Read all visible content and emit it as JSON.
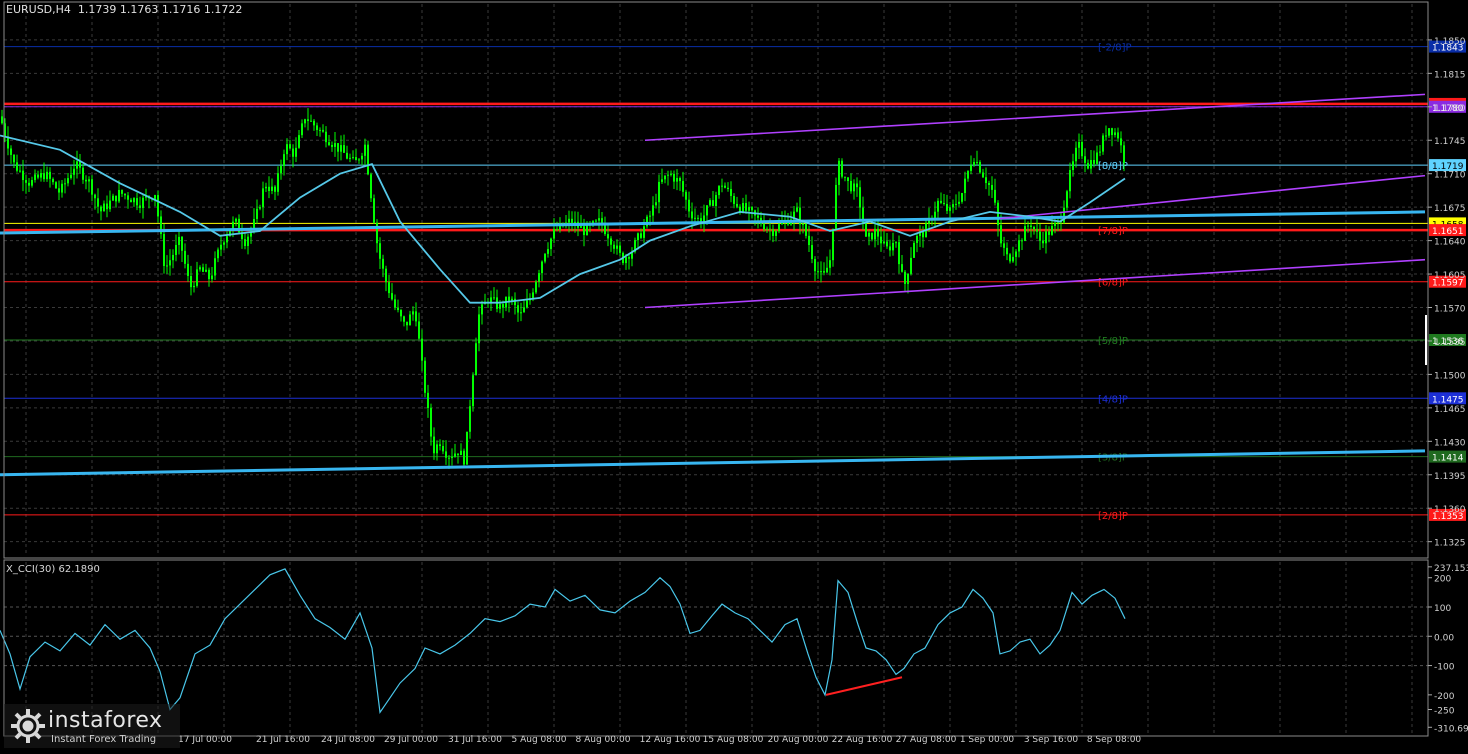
{
  "header": {
    "symbol_line": "EURUSD,H4  1.1739 1.1763 1.1716 1.1722",
    "indicator_line": "X_CCI(30) 62.1890"
  },
  "watermark": {
    "name": "instaforex",
    "tagline": "Instant Forex Trading"
  },
  "colors": {
    "background": "#000000",
    "grid": "#3a3a3a",
    "candle": "#00ff00",
    "ma": "#55c8e8",
    "support_trend": "#38b6f0",
    "channel": "#b040ff",
    "red_level": "#ff1a1a",
    "yellow_level": "#ffff00",
    "cci": "#49c7ea",
    "divergence": "#ff2020"
  },
  "chart_data": [
    {
      "type": "candlestick",
      "symbol": "EURUSD",
      "timeframe": "H4",
      "ylim": [
        1.131,
        1.1875
      ],
      "y_ticks": [
        "1.1850",
        "1.1815",
        "1.1780",
        "1.1745",
        "1.1710",
        "1.1675",
        "1.1640",
        "1.1605",
        "1.1570",
        "1.1535",
        "1.1500",
        "1.1465",
        "1.1430",
        "1.1395",
        "1.1360",
        "1.1325"
      ],
      "x_ticks": [
        "17 Jul 00:00",
        "21 Jul 16:00",
        "24 Jul 08:00",
        "29 Jul 00:00",
        "31 Jul 16:00",
        "5 Aug 08:00",
        "8 Aug 00:00",
        "12 Aug 16:00",
        "15 Aug 08:00",
        "20 Aug 00:00",
        "22 Aug 16:00",
        "27 Aug 08:00",
        "1 Sep 00:00",
        "3 Sep 16:00",
        "8 Sep 08:00"
      ],
      "close_path": [
        [
          0,
          1.177
        ],
        [
          14,
          1.172
        ],
        [
          30,
          1.17
        ],
        [
          45,
          1.171
        ],
        [
          60,
          1.169
        ],
        [
          75,
          1.172
        ],
        [
          90,
          1.17
        ],
        [
          100,
          1.167
        ],
        [
          120,
          1.169
        ],
        [
          140,
          1.168
        ],
        [
          155,
          1.169
        ],
        [
          165,
          1.161
        ],
        [
          180,
          1.164
        ],
        [
          190,
          1.159
        ],
        [
          200,
          1.161
        ],
        [
          210,
          1.16
        ],
        [
          222,
          1.164
        ],
        [
          235,
          1.166
        ],
        [
          245,
          1.164
        ],
        [
          255,
          1.166
        ],
        [
          265,
          1.17
        ],
        [
          275,
          1.169
        ],
        [
          285,
          1.174
        ],
        [
          295,
          1.173
        ],
        [
          305,
          1.177
        ],
        [
          315,
          1.176
        ],
        [
          325,
          1.175
        ],
        [
          335,
          1.174
        ],
        [
          345,
          1.173
        ],
        [
          355,
          1.172
        ],
        [
          365,
          1.174
        ],
        [
          372,
          1.168
        ],
        [
          378,
          1.163
        ],
        [
          385,
          1.16
        ],
        [
          395,
          1.157
        ],
        [
          405,
          1.155
        ],
        [
          415,
          1.157
        ],
        [
          423,
          1.15
        ],
        [
          428,
          1.146
        ],
        [
          433,
          1.142
        ],
        [
          440,
          1.143
        ],
        [
          448,
          1.1415
        ],
        [
          458,
          1.142
        ],
        [
          465,
          1.141
        ],
        [
          470,
          1.147
        ],
        [
          478,
          1.156
        ],
        [
          488,
          1.158
        ],
        [
          500,
          1.157
        ],
        [
          510,
          1.158
        ],
        [
          520,
          1.156
        ],
        [
          530,
          1.158
        ],
        [
          545,
          1.163
        ],
        [
          555,
          1.165
        ],
        [
          570,
          1.166
        ],
        [
          585,
          1.165
        ],
        [
          600,
          1.166
        ],
        [
          612,
          1.164
        ],
        [
          622,
          1.162
        ],
        [
          632,
          1.163
        ],
        [
          642,
          1.165
        ],
        [
          652,
          1.167
        ],
        [
          660,
          1.17
        ],
        [
          670,
          1.171
        ],
        [
          680,
          1.17
        ],
        [
          690,
          1.167
        ],
        [
          700,
          1.166
        ],
        [
          712,
          1.168
        ],
        [
          722,
          1.17
        ],
        [
          735,
          1.168
        ],
        [
          748,
          1.167
        ],
        [
          760,
          1.166
        ],
        [
          772,
          1.165
        ],
        [
          785,
          1.166
        ],
        [
          797,
          1.167
        ],
        [
          808,
          1.164
        ],
        [
          816,
          1.161
        ],
        [
          823,
          1.16
        ],
        [
          830,
          1.162
        ],
        [
          838,
          1.172
        ],
        [
          848,
          1.17
        ],
        [
          858,
          1.169
        ],
        [
          866,
          1.164
        ],
        [
          876,
          1.165
        ],
        [
          886,
          1.163
        ],
        [
          896,
          1.164
        ],
        [
          904,
          1.159
        ],
        [
          914,
          1.164
        ],
        [
          925,
          1.165
        ],
        [
          938,
          1.168
        ],
        [
          950,
          1.167
        ],
        [
          962,
          1.169
        ],
        [
          973,
          1.173
        ],
        [
          983,
          1.171
        ],
        [
          993,
          1.169
        ],
        [
          1000,
          1.164
        ],
        [
          1008,
          1.162
        ],
        [
          1020,
          1.164
        ],
        [
          1030,
          1.166
        ],
        [
          1040,
          1.164
        ],
        [
          1050,
          1.165
        ],
        [
          1060,
          1.166
        ],
        [
          1068,
          1.17
        ],
        [
          1078,
          1.174
        ],
        [
          1088,
          1.172
        ],
        [
          1098,
          1.173
        ],
        [
          1108,
          1.176
        ],
        [
          1118,
          1.175
        ],
        [
          1125,
          1.1722
        ]
      ],
      "ma_path": [
        [
          0,
          1.175
        ],
        [
          60,
          1.1735
        ],
        [
          120,
          1.17
        ],
        [
          180,
          1.167
        ],
        [
          220,
          1.1645
        ],
        [
          260,
          1.165
        ],
        [
          300,
          1.1685
        ],
        [
          340,
          1.171
        ],
        [
          372,
          1.172
        ],
        [
          400,
          1.166
        ],
        [
          440,
          1.161
        ],
        [
          470,
          1.1575
        ],
        [
          500,
          1.1575
        ],
        [
          540,
          1.158
        ],
        [
          580,
          1.1605
        ],
        [
          620,
          1.162
        ],
        [
          650,
          1.164
        ],
        [
          690,
          1.1655
        ],
        [
          740,
          1.167
        ],
        [
          790,
          1.1665
        ],
        [
          830,
          1.165
        ],
        [
          870,
          1.166
        ],
        [
          910,
          1.1645
        ],
        [
          950,
          1.166
        ],
        [
          990,
          1.167
        ],
        [
          1030,
          1.1665
        ],
        [
          1060,
          1.166
        ],
        [
          1090,
          1.168
        ],
        [
          1125,
          1.1705
        ]
      ],
      "support_trend": {
        "from": [
          0,
          1.1648
        ],
        "to": [
          1425,
          1.167
        ]
      },
      "support_trend_low": {
        "from": [
          0,
          1.1395
        ],
        "to": [
          1425,
          1.142
        ]
      },
      "channel": [
        {
          "from": [
            645,
            1.1745
          ],
          "to": [
            1425,
            1.1793
          ]
        },
        {
          "from": [
            645,
            1.157
          ],
          "to": [
            1425,
            1.162
          ]
        },
        {
          "from": [
            1000,
            1.1663
          ],
          "to": [
            1425,
            1.1708
          ]
        }
      ],
      "levels": [
        {
          "value": 1.1843,
          "label": "1.1843",
          "color": "#0a2ea8",
          "murrey": "[-2/8]P"
        },
        {
          "value": 1.1783,
          "label": "1.1783",
          "color": "#ff1a1a",
          "thick": true
        },
        {
          "value": 1.178,
          "label": "1.1780",
          "color": "#8a2be2",
          "murrey": ""
        },
        {
          "value": 1.1719,
          "label": "1.1719",
          "color": "#5fd3ff",
          "murrey": "[8/8]P"
        },
        {
          "value": 1.1658,
          "label": "1.1658",
          "color": "#ffff00"
        },
        {
          "value": 1.1651,
          "label": "1.1651",
          "color": "#ff1a1a",
          "thick": true,
          "murrey": "[7/8]P"
        },
        {
          "value": 1.1597,
          "label": "1.1597",
          "color": "#ff1a1a",
          "murrey": "[6/8]P"
        },
        {
          "value": 1.1536,
          "label": "1.1536",
          "color": "#1f7a1f",
          "murrey": "[5/8]P"
        },
        {
          "value": 1.1475,
          "label": "1.1475",
          "color": "#1c2fd6",
          "murrey": "[4/8]P"
        },
        {
          "value": 1.1414,
          "label": "1.1414",
          "color": "#1f6a1f",
          "murrey": "[3/8]P"
        },
        {
          "value": 1.1353,
          "label": "1.1353",
          "color": "#ff1a1a",
          "murrey": "[2/8]P"
        }
      ]
    },
    {
      "type": "line",
      "name": "X_CCI(30)",
      "ylim": [
        -320,
        240
      ],
      "y_ticks": [
        "237.1533",
        "200",
        "100",
        "0.00",
        "-100",
        "-200",
        "-250",
        "-310.6910"
      ],
      "values": [
        [
          0,
          20
        ],
        [
          10,
          -60
        ],
        [
          20,
          -180
        ],
        [
          30,
          -70
        ],
        [
          45,
          -20
        ],
        [
          60,
          -50
        ],
        [
          75,
          10
        ],
        [
          90,
          -30
        ],
        [
          105,
          40
        ],
        [
          120,
          -10
        ],
        [
          135,
          20
        ],
        [
          150,
          -40
        ],
        [
          160,
          -120
        ],
        [
          170,
          -250
        ],
        [
          180,
          -210
        ],
        [
          195,
          -60
        ],
        [
          210,
          -30
        ],
        [
          225,
          60
        ],
        [
          240,
          110
        ],
        [
          255,
          160
        ],
        [
          270,
          210
        ],
        [
          285,
          230
        ],
        [
          300,
          140
        ],
        [
          315,
          60
        ],
        [
          330,
          30
        ],
        [
          345,
          -10
        ],
        [
          360,
          80
        ],
        [
          372,
          -40
        ],
        [
          380,
          -260
        ],
        [
          390,
          -210
        ],
        [
          400,
          -160
        ],
        [
          415,
          -110
        ],
        [
          425,
          -40
        ],
        [
          440,
          -60
        ],
        [
          455,
          -30
        ],
        [
          470,
          10
        ],
        [
          485,
          60
        ],
        [
          500,
          50
        ],
        [
          515,
          70
        ],
        [
          530,
          110
        ],
        [
          545,
          100
        ],
        [
          555,
          160
        ],
        [
          570,
          120
        ],
        [
          585,
          140
        ],
        [
          600,
          90
        ],
        [
          615,
          80
        ],
        [
          630,
          120
        ],
        [
          645,
          150
        ],
        [
          660,
          200
        ],
        [
          670,
          170
        ],
        [
          680,
          110
        ],
        [
          690,
          10
        ],
        [
          700,
          20
        ],
        [
          712,
          70
        ],
        [
          722,
          110
        ],
        [
          735,
          80
        ],
        [
          748,
          60
        ],
        [
          760,
          20
        ],
        [
          772,
          -20
        ],
        [
          785,
          40
        ],
        [
          797,
          60
        ],
        [
          808,
          -60
        ],
        [
          816,
          -140
        ],
        [
          825,
          -200
        ],
        [
          832,
          -80
        ],
        [
          838,
          190
        ],
        [
          848,
          150
        ],
        [
          858,
          40
        ],
        [
          866,
          -40
        ],
        [
          876,
          -50
        ],
        [
          886,
          -80
        ],
        [
          896,
          -130
        ],
        [
          904,
          -110
        ],
        [
          914,
          -60
        ],
        [
          925,
          -40
        ],
        [
          938,
          40
        ],
        [
          950,
          80
        ],
        [
          962,
          100
        ],
        [
          973,
          160
        ],
        [
          983,
          130
        ],
        [
          993,
          80
        ],
        [
          1000,
          -60
        ],
        [
          1010,
          -50
        ],
        [
          1020,
          -20
        ],
        [
          1030,
          -10
        ],
        [
          1040,
          -60
        ],
        [
          1050,
          -30
        ],
        [
          1060,
          20
        ],
        [
          1072,
          150
        ],
        [
          1082,
          110
        ],
        [
          1092,
          140
        ],
        [
          1104,
          160
        ],
        [
          1115,
          130
        ],
        [
          1125,
          60
        ]
      ],
      "divergence": {
        "from": [
          826,
          -200
        ],
        "to": [
          902,
          -140
        ]
      }
    }
  ]
}
